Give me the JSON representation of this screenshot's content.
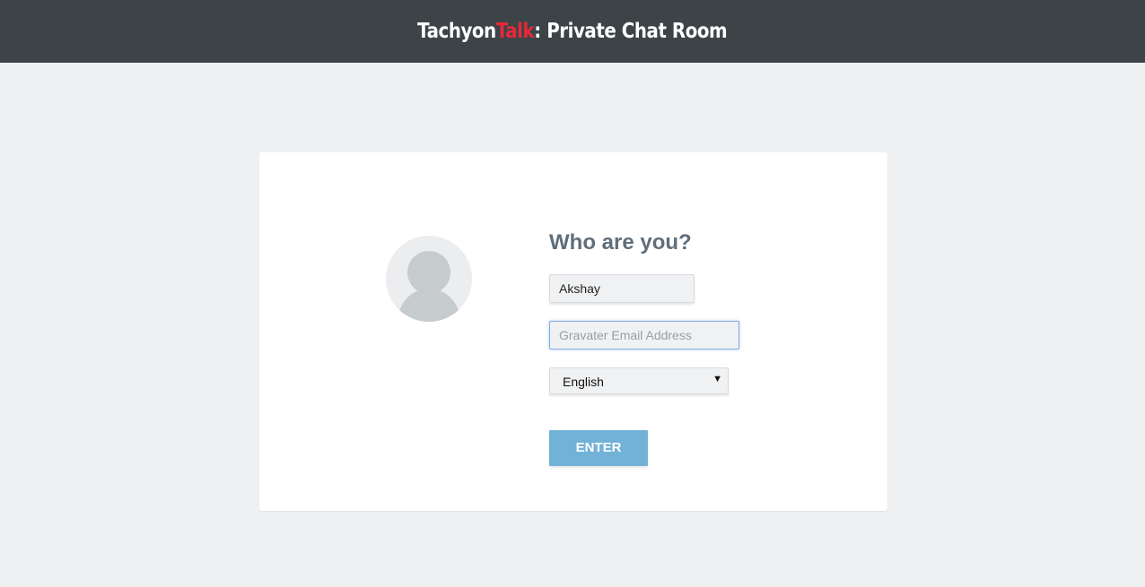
{
  "header": {
    "title_part1": "Tachyon",
    "title_accent": "Talk",
    "title_rest": ": Private Chat Room",
    "background_color": "#3c4447",
    "accent_color": "#e8283a"
  },
  "login": {
    "avatar_icon": "default-user-avatar-icon",
    "title": "Who are you?",
    "name_value": "Akshay",
    "email_value": "",
    "email_placeholder": "Gravater Email Address",
    "language_selected": "English",
    "language_caret": "▼",
    "enter_label": "ENTER",
    "button_color": "#72b2d6"
  }
}
